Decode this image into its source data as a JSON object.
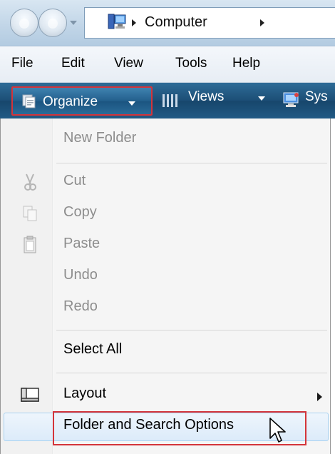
{
  "address_bar": {
    "path_label": "Computer"
  },
  "menu_bar": {
    "items": [
      "File",
      "Edit",
      "View",
      "Tools",
      "Help"
    ]
  },
  "command_bar": {
    "organize_label": "Organize",
    "views_label": "Views",
    "system_label_partial": "Sys"
  },
  "organize_menu": {
    "items": [
      {
        "label": "New Folder",
        "enabled": false,
        "icon": ""
      },
      {
        "label": "Cut",
        "enabled": false,
        "icon": "scissors-icon"
      },
      {
        "label": "Copy",
        "enabled": false,
        "icon": "copy-icon"
      },
      {
        "label": "Paste",
        "enabled": false,
        "icon": "clipboard-icon"
      },
      {
        "label": "Undo",
        "enabled": false,
        "icon": ""
      },
      {
        "label": "Redo",
        "enabled": false,
        "icon": ""
      },
      {
        "label": "Select All",
        "enabled": true,
        "icon": ""
      },
      {
        "label": "Layout",
        "enabled": true,
        "icon": "layout-icon",
        "has_submenu": true
      },
      {
        "label": "Folder and Search Options",
        "enabled": true,
        "icon": "",
        "hovered": true
      }
    ]
  },
  "colors": {
    "command_bar": "#1c4e76",
    "highlight_box": "#d4343a",
    "hover_row": "#dcebfa",
    "disabled_text": "#8d8d8d"
  }
}
